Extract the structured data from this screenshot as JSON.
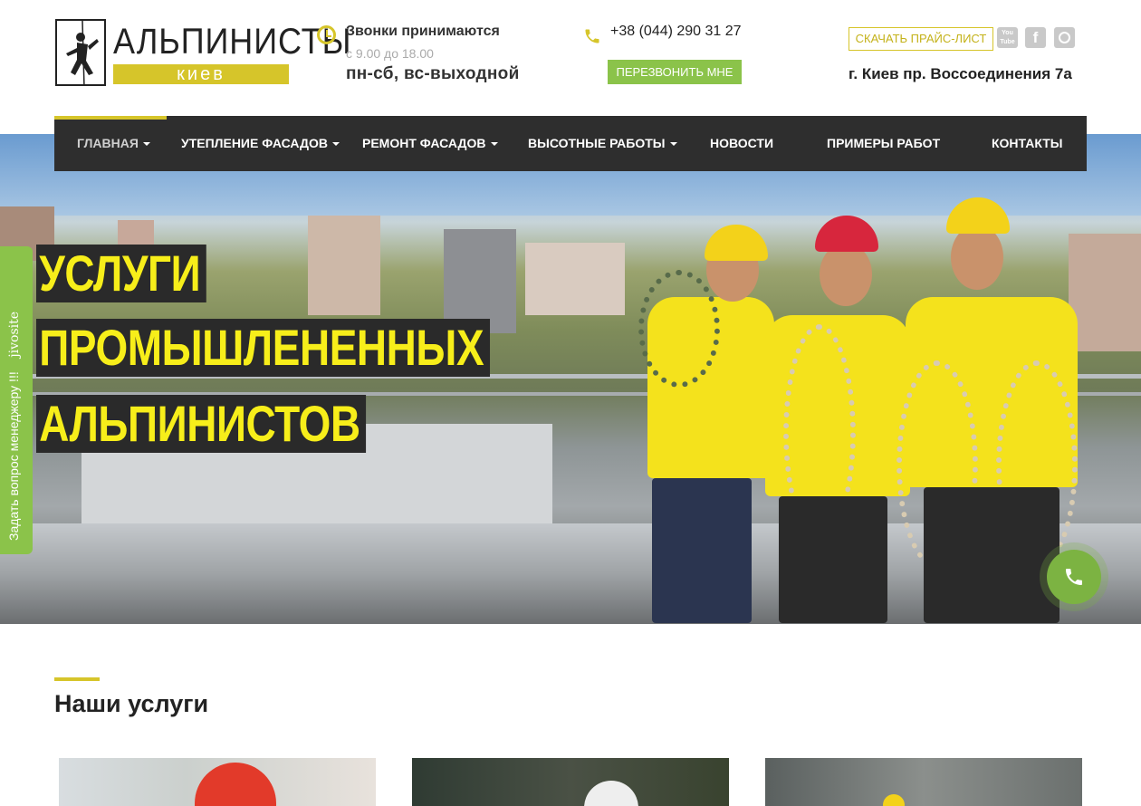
{
  "brand": {
    "name": "АЛЬПИНИСТЫ",
    "city": "киев"
  },
  "schedule": {
    "title": "Звонки принимаются",
    "hours": "с 9.00 до 18.00",
    "days": "пн-сб, вс-выходной"
  },
  "contact": {
    "phone": "+38 (044) 290 31 27",
    "callback_label": "ПЕРЕЗВОНИТЬ МНЕ",
    "price_label": "СКАЧАТЬ ПРАЙС-ЛИСТ",
    "address": "г. Киев пр. Воссоединения 7а"
  },
  "social": {
    "youtube_label": "You Tube",
    "facebook_label": "f"
  },
  "nav": {
    "items": [
      {
        "label": "ГЛАВНАЯ"
      },
      {
        "label": "УТЕПЛЕНИЕ ФАСАДОВ"
      },
      {
        "label": "РЕМОНТ ФАСАДОВ"
      },
      {
        "label": "ВЫСОТНЫЕ РАБОТЫ"
      },
      {
        "label": "НОВОСТИ"
      },
      {
        "label": "ПРИМЕРЫ РАБОТ"
      },
      {
        "label": "КОНТАКТЫ"
      }
    ]
  },
  "hero": {
    "line1": "УСЛУГИ",
    "line2": "ПРОМЫШЛЕНЕННЫХ",
    "line3": "АЛЬПИНИСТОВ"
  },
  "side_tab": {
    "label": "Задать вопрос менеджеру !!!",
    "brand": "jivosite"
  },
  "services": {
    "title": "Наши услуги"
  },
  "colors": {
    "accent": "#d6c52a",
    "green": "#8bc34a",
    "nav_bg": "#2e2e2e",
    "headline_text": "#f7ee1a"
  }
}
